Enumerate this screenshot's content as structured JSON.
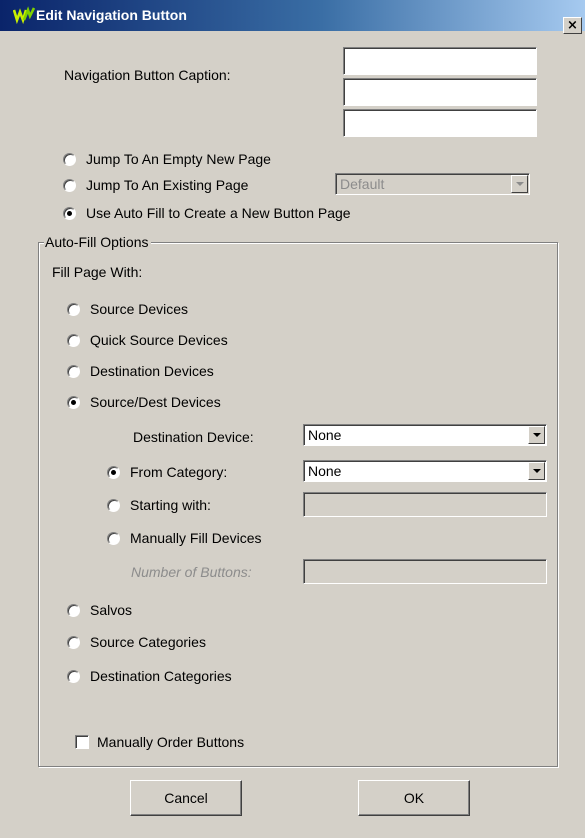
{
  "window": {
    "title": "Edit Navigation Button",
    "close_glyph": "×"
  },
  "caption": {
    "label": "Navigation Button Caption:",
    "lines": [
      "",
      "",
      ""
    ]
  },
  "page_options": [
    {
      "label": "Jump To An Empty New Page",
      "checked": false
    },
    {
      "label": "Jump To An Existing Page",
      "checked": false
    },
    {
      "label": "Use Auto Fill to Create a New Button Page",
      "checked": true
    }
  ],
  "existing_page_select": {
    "value": "Default",
    "enabled": false
  },
  "autofill": {
    "group_title": "Auto-Fill Options",
    "fill_label": "Fill Page With:",
    "fill_options": [
      {
        "label": "Source Devices",
        "checked": false
      },
      {
        "label": "Quick Source Devices",
        "checked": false
      },
      {
        "label": "Destination Devices",
        "checked": false
      },
      {
        "label": "Source/Dest Devices",
        "checked": true
      }
    ],
    "destination_device": {
      "label": "Destination Device:",
      "value": "None"
    },
    "sub_options": [
      {
        "label": "From Category:",
        "checked": true
      },
      {
        "label": "Starting with:",
        "checked": false
      },
      {
        "label": "Manually Fill Devices",
        "checked": false
      }
    ],
    "category_select": {
      "value": "None"
    },
    "starting_with_value": "",
    "number_of_buttons": {
      "label": "Number of Buttons:",
      "value": "",
      "enabled": false
    },
    "more_options": [
      {
        "label": "Salvos",
        "checked": false
      },
      {
        "label": "Source Categories",
        "checked": false
      },
      {
        "label": "Destination Categories",
        "checked": false
      }
    ],
    "manual_order": {
      "label": "Manually Order Buttons",
      "checked": false
    }
  },
  "buttons": {
    "cancel": "Cancel",
    "ok": "OK"
  }
}
